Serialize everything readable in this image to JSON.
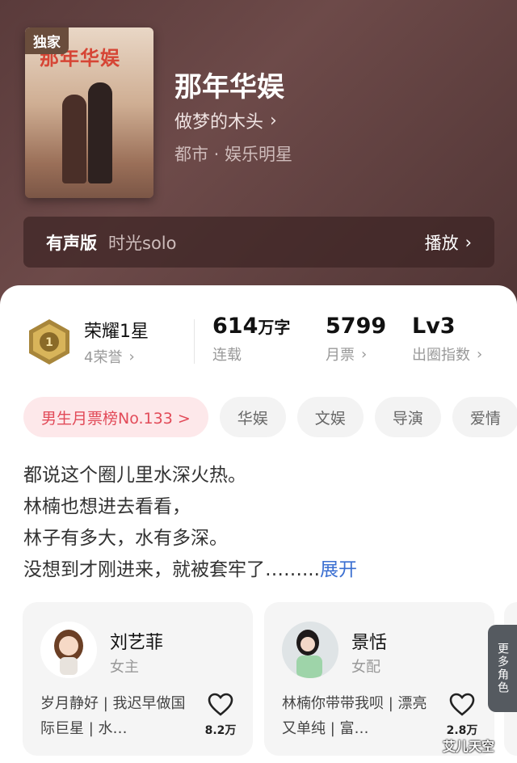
{
  "book": {
    "badge": "独家",
    "cover_title": "那年华娱",
    "title": "那年华娱",
    "author": "做梦的木头",
    "genre": "都市 · 娱乐明星"
  },
  "audio": {
    "label": "有声版",
    "narrator": "时光solo",
    "play": "播放"
  },
  "honor": {
    "title": "荣耀1星",
    "sub": "4荣誉"
  },
  "stats": [
    {
      "value": "614",
      "unit": "万字",
      "label": "连载"
    },
    {
      "value": "5799",
      "unit": "",
      "label": "月票"
    },
    {
      "value": "Lv3",
      "unit": "",
      "label": "出圈指数"
    }
  ],
  "tags": [
    "男生月票榜No.133 >",
    "华娱",
    "文娱",
    "导演",
    "爱情"
  ],
  "description": {
    "lines": [
      "都说这个圈儿里水深火热。",
      "林楠也想进去看看，",
      "林子有多大，水有多深。",
      "没想到才刚进来，就被套牢了……..."
    ],
    "expand": "展开"
  },
  "characters": [
    {
      "name": "刘艺菲",
      "role": "女主",
      "tags": "岁月静好 | 我迟早做国际巨星 | 水…",
      "likes": "8.2万"
    },
    {
      "name": "景恬",
      "role": "女配",
      "tags": "林楠你带带我呗 | 漂亮又单纯 | 富…",
      "likes": "2.8万"
    }
  ],
  "more_roles": "更多角色",
  "watermark": "艾儿天空",
  "colors": {
    "accent_blue": "#3b6fd1",
    "rank_red": "#e24a58",
    "hero_bg": "#5a3b3b"
  }
}
